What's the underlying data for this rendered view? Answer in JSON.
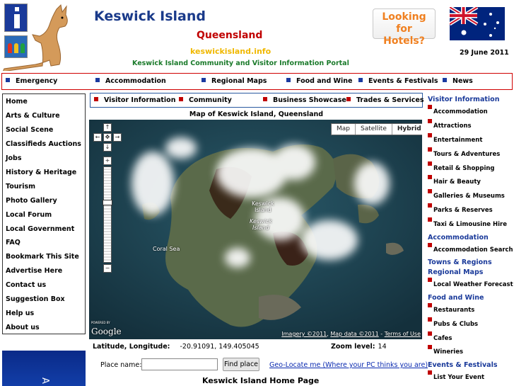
{
  "header": {
    "title": "Keswick Island",
    "state": "Queensland",
    "domain": "keswickisland.info",
    "tagline": "Keswick Island Community and Visitor Information Portal",
    "date": "29 June 2011",
    "hotels_button": "Looking for Hotels?",
    "icons": [
      "info-icon",
      "family-icon",
      "kangaroo-logo",
      "australian-flag"
    ]
  },
  "top_nav": [
    "Emergency",
    "Accommodation",
    "Regional Maps",
    "Food and Wine",
    "Events & Festivals",
    "News"
  ],
  "left_nav": [
    "Home",
    "Arts & Culture",
    "Social Scene",
    "Classifieds Auctions",
    "Jobs",
    "History & Heritage",
    "Tourism",
    "Photo Gallery",
    "Local Forum",
    "Local Government",
    "FAQ",
    "Bookmark This Site",
    "Advertise Here",
    "Contact us",
    "Suggestion Box",
    "Help us",
    "About us"
  ],
  "sub_nav": [
    "Visitor Information",
    "Community",
    "Business Showcase",
    "Trades & Services"
  ],
  "map": {
    "title": "Map of Keswick Island, Queensland",
    "types": [
      "Map",
      "Satellite",
      "Hybrid"
    ],
    "selected_type": "Hybrid",
    "labels": {
      "island": "Keswick\nIsland",
      "island_italic": "Keswick\nIsland",
      "sea": "Coral Sea"
    },
    "credit_imagery": "Imagery ©2011",
    "credit_data": "Map data ©2011",
    "credit_terms": "Terms of Use",
    "logo": "Google",
    "logo_small": "POWERED BY",
    "pan_glyphs": {
      "up": "↑",
      "left": "←",
      "center": "✥",
      "right": "→",
      "down": "↓",
      "zoom_in": "+",
      "zoom_out": "−"
    }
  },
  "coords": {
    "label": "Latitude, Longitude:",
    "value": "-20.91091, 149.405045",
    "zoom_label": "Zoom level:",
    "zoom_value": "14"
  },
  "search": {
    "label": "Place name:",
    "placeholder": "",
    "button": "Find place",
    "geo_link": "Geo-Locate me (Where your PC thinks you are)"
  },
  "page_title": "Keswick Island Home Page",
  "ad_text": "A",
  "right_sidebar": {
    "visitor_heading": "Visitor Information",
    "visitor_items": [
      "Accommodation",
      "Attractions",
      "Entertainment",
      "Tours & Adventures",
      "Retail & Shopping",
      "Hair & Beauty",
      "Galleries & Museums",
      "Parks & Reserves",
      "Taxi & Limousine Hire"
    ],
    "accommodation_heading": "Accommodation",
    "accommodation_items": [
      "Accommodation Search"
    ],
    "towns_heading": "Towns & Regions",
    "maps_heading": "Regional Maps",
    "maps_items": [
      "Local Weather Forecast"
    ],
    "food_heading": "Food and Wine",
    "food_items": [
      "Restaurants",
      "Pubs & Clubs",
      "Cafes",
      "Wineries"
    ],
    "events_heading": "Events & Festivals",
    "events_items": [
      "List Your Event"
    ]
  },
  "colors": {
    "title_blue": "#1a3a8a",
    "state_red": "#c00000",
    "domain_gold": "#f0b800",
    "tagline_green": "#1a7a2a",
    "hotels_orange": "#f08020",
    "nav_border_red": "#d00000",
    "link_blue": "#0a2ab0"
  }
}
